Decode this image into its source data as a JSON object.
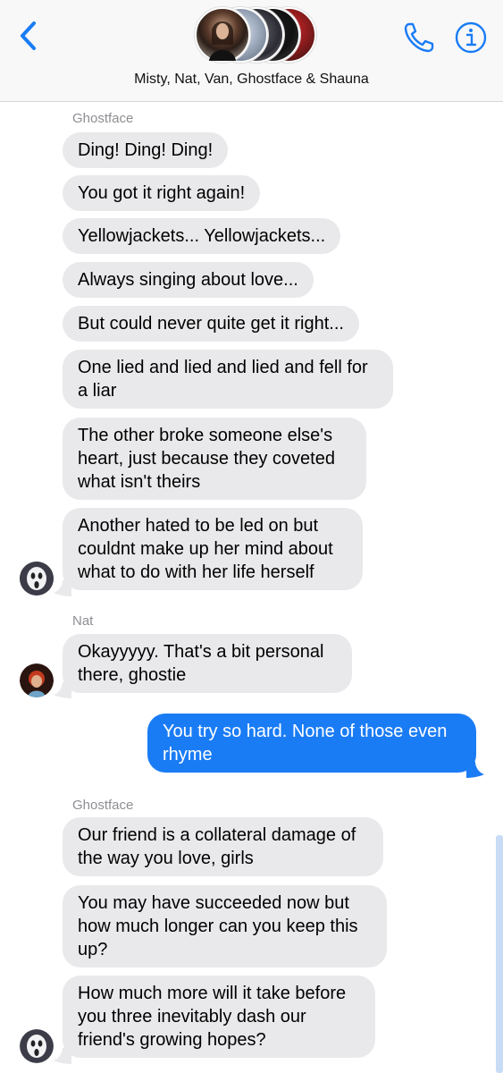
{
  "header": {
    "group_name": "Misty, Nat, Van, Ghostface & Shauna",
    "back_icon": "chevron-left-icon",
    "call_icon": "phone-icon",
    "info_icon": "info-icon",
    "accent_color": "#1a7cf5"
  },
  "thread": {
    "senders": {
      "ghostface_1": "Ghostface",
      "nat": "Nat",
      "ghostface_2": "Ghostface"
    },
    "messages": [
      {
        "from": "Ghostface",
        "text": "Ding! Ding! Ding!"
      },
      {
        "from": "Ghostface",
        "text": "You got it right again!"
      },
      {
        "from": "Ghostface",
        "text": "Yellowjackets... Yellowjackets..."
      },
      {
        "from": "Ghostface",
        "text": "Always singing about love..."
      },
      {
        "from": "Ghostface",
        "text": "But could never quite get it right..."
      },
      {
        "from": "Ghostface",
        "text": "One lied and lied and lied and fell for a liar"
      },
      {
        "from": "Ghostface",
        "text": "The other broke someone else's heart, just because they coveted what isn't theirs"
      },
      {
        "from": "Ghostface",
        "text": "Another hated to be led on but couldnt make up her mind about what to do with her life herself"
      },
      {
        "from": "Nat",
        "text": "Okayyyyy. That's a bit personal there, ghostie"
      },
      {
        "from": "me",
        "text": "You try so hard. None of those even rhyme"
      },
      {
        "from": "Ghostface",
        "text": "Our friend is a collateral damage of the way you love, girls"
      },
      {
        "from": "Ghostface",
        "text": "You may have succeeded now but how much longer can you keep this up?"
      },
      {
        "from": "Ghostface",
        "text": "How much more will it take before you three inevitably dash our friend's growing hopes?"
      }
    ]
  }
}
